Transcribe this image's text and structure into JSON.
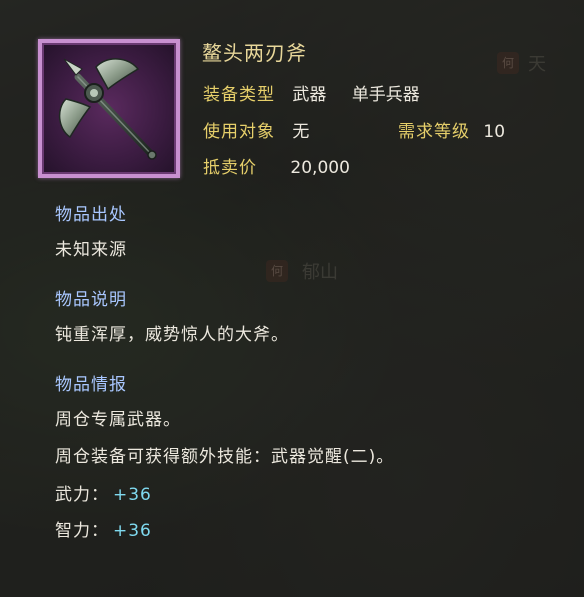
{
  "item": {
    "name": "鳌头两刃斧",
    "equip_type_label": "装备类型",
    "equip_type_value": "武器",
    "equip_subtype_value": "单手兵器",
    "user_label": "使用对象",
    "user_value": "无",
    "req_level_label": "需求等级",
    "req_level_value": "10",
    "price_label": "抵卖价",
    "price_value": "20,000",
    "icon": "battle-axe-icon",
    "frame_color": "#c890d0"
  },
  "source": {
    "heading": "物品出处",
    "text": "未知来源"
  },
  "description": {
    "heading": "物品说明",
    "text": "钝重浑厚，威势惊人的大斧。"
  },
  "info": {
    "heading": "物品情报",
    "lines": [
      "周仓专属武器。",
      "周仓装备可获得额外技能：武器觉醒(二)。"
    ]
  },
  "stats": [
    {
      "label": "武力：",
      "value": "+36"
    },
    {
      "label": "智力：",
      "value": "+36"
    }
  ],
  "map": {
    "seal_glyph": "何",
    "place_1": "天",
    "place_2": "郁山"
  }
}
